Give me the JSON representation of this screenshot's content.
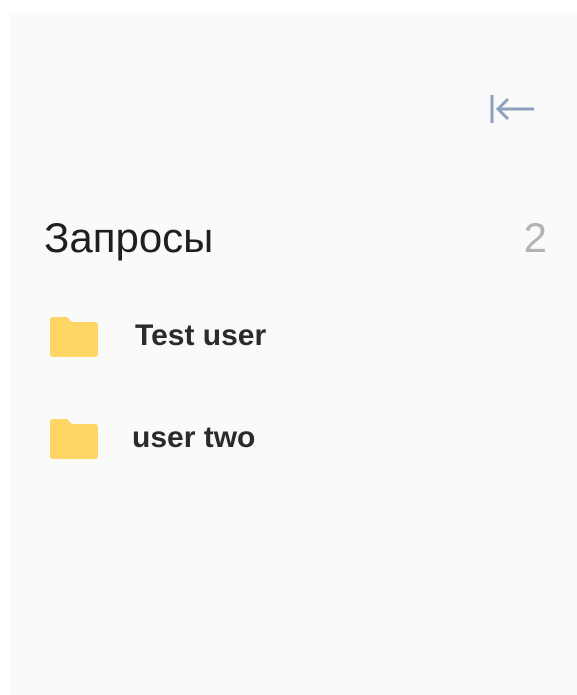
{
  "sidebar": {
    "collapse_icon": "collapse-left-icon",
    "section": {
      "title": "Запросы",
      "count": "2"
    },
    "items": [
      {
        "label": "Test user",
        "icon": "folder-icon"
      },
      {
        "label": "user two",
        "icon": "folder-icon"
      }
    ]
  },
  "colors": {
    "panel_background": "#fafafa",
    "folder_icon": "#ffd666",
    "collapse_icon": "#8ea2c0",
    "count_text": "#b3b3b3"
  }
}
